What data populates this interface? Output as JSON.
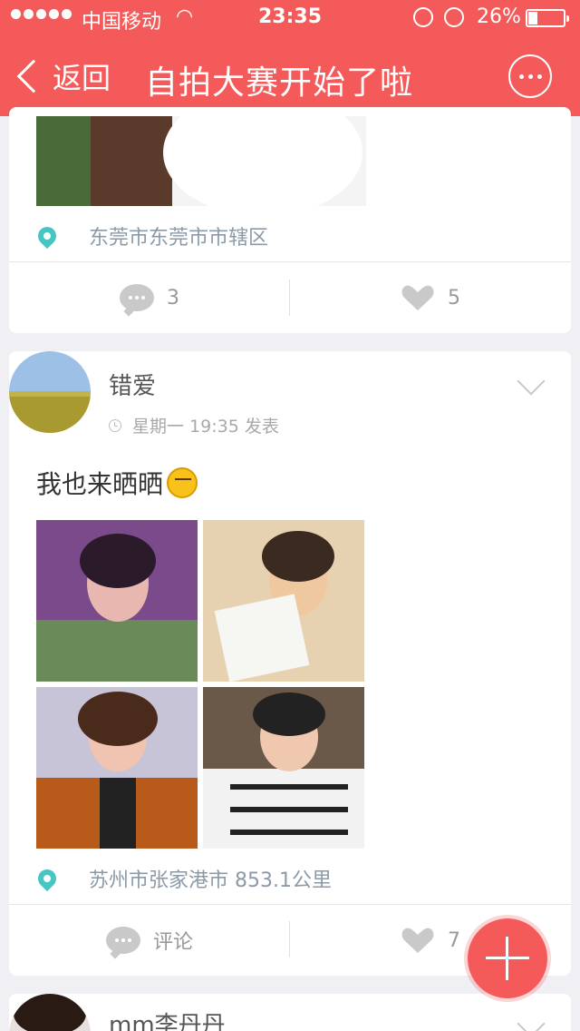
{
  "status_bar": {
    "carrier": "中国移动",
    "time": "23:35",
    "battery_percent": "26%",
    "battery_level": 0.26
  },
  "nav": {
    "back_label": "返回",
    "title": "自拍大赛开始了啦"
  },
  "posts": [
    {
      "location": "东莞市东莞市市辖区",
      "comments_label": "3",
      "likes_label": "5"
    },
    {
      "username": "错爱",
      "timestamp": "星期一 19:35 发表",
      "text": "我也来晒晒",
      "location": "苏州市张家港市 853.1公里",
      "comments_label": "评论",
      "likes_label": "7"
    },
    {
      "username": "mm李丹丹"
    }
  ],
  "colors": {
    "accent": "#f55a5a",
    "location_pin": "#46c6c2"
  }
}
